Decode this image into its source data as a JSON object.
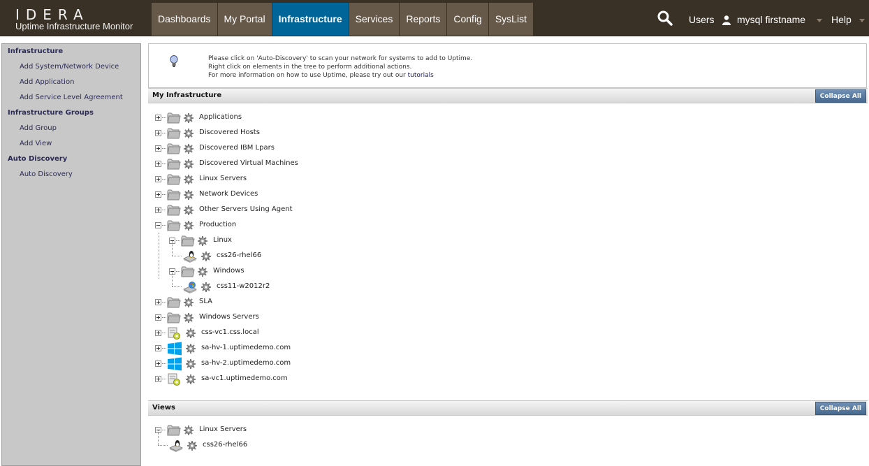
{
  "brand": {
    "logo": "IDERA",
    "subtitle": "Uptime Infrastructure Monitor"
  },
  "nav": [
    {
      "label": "Dashboards"
    },
    {
      "label": "My Portal"
    },
    {
      "label": "Infrastructure",
      "active": true
    },
    {
      "label": "Services"
    },
    {
      "label": "Reports"
    },
    {
      "label": "Config"
    },
    {
      "label": "SysList"
    }
  ],
  "header_right": {
    "users_label": "Users",
    "username": "mysql firstname",
    "help_label": "Help"
  },
  "sidebar": {
    "sections": [
      {
        "title": "Infrastructure",
        "links": [
          "Add System/Network Device",
          "Add Application",
          "Add Service Level Agreement"
        ]
      },
      {
        "title": "Infrastructure Groups",
        "links": [
          "Add Group",
          "Add View"
        ]
      },
      {
        "title": "Auto Discovery",
        "links": [
          "Auto Discovery"
        ]
      }
    ]
  },
  "info": {
    "line1": "Please click on 'Auto-Discovery' to scan your network for systems to add to Uptime.",
    "line2": "Right click on elements in the tree to perform additional actions.",
    "line3_prefix": "For more information on how to use Uptime, please try out our",
    "line3_link": "tutorials"
  },
  "my_infrastructure": {
    "title": "My Infrastructure",
    "collapse_label": "Collapse All",
    "nodes": [
      {
        "label": "Applications",
        "type": "folder"
      },
      {
        "label": "Discovered Hosts",
        "type": "folder"
      },
      {
        "label": "Discovered IBM Lpars",
        "type": "folder"
      },
      {
        "label": "Discovered Virtual Machines",
        "type": "folder"
      },
      {
        "label": "Linux Servers",
        "type": "folder"
      },
      {
        "label": "Network Devices",
        "type": "folder"
      },
      {
        "label": "Other Servers Using Agent",
        "type": "folder"
      },
      {
        "label": "Production",
        "type": "folder",
        "expanded": true
      },
      {
        "label": "Linux",
        "type": "folder",
        "expanded": true,
        "level": 1
      },
      {
        "label": "css26-rhel66",
        "type": "linux-host",
        "level": 2
      },
      {
        "label": "Windows",
        "type": "folder",
        "expanded": true,
        "level": 1
      },
      {
        "label": "css11-w2012r2",
        "type": "windows-host",
        "level": 2
      },
      {
        "label": "SLA",
        "type": "folder"
      },
      {
        "label": "Windows Servers",
        "type": "folder"
      },
      {
        "label": "css-vc1.css.local",
        "type": "vcenter"
      },
      {
        "label": "sa-hv-1.uptimedemo.com",
        "type": "hyperv"
      },
      {
        "label": "sa-hv-2.uptimedemo.com",
        "type": "hyperv"
      },
      {
        "label": "sa-vc1.uptimedemo.com",
        "type": "vcenter"
      }
    ]
  },
  "views": {
    "title": "Views",
    "collapse_label": "Collapse All",
    "nodes": [
      {
        "label": "Linux Servers",
        "type": "folder",
        "expanded": true
      },
      {
        "label": "css26-rhel66",
        "type": "linux-host",
        "level": 1
      }
    ]
  }
}
